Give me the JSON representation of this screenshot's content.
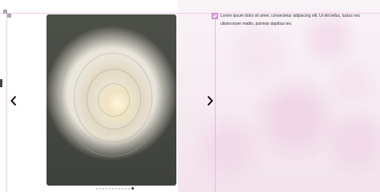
{
  "carousel": {
    "prev_icon": "chevron-left-icon",
    "next_icon": "chevron-right-icon",
    "slide_alt": "white rose",
    "pagination": {
      "count": 12,
      "active": 11
    },
    "caption": "Lorem ipsum dolor sit amet, consectetur adipiscing elit. Ut elit tellus, luctus nec ullamcorper mattis, pulvinar dapibus leo."
  },
  "editor": {
    "handle_icon": "drag-handle-icon",
    "checkbox_checked": true
  },
  "colors": {
    "guide": "#f2c8ef",
    "checkbox": "#e3a8df",
    "text": "#333333",
    "arrow": "#111111"
  }
}
